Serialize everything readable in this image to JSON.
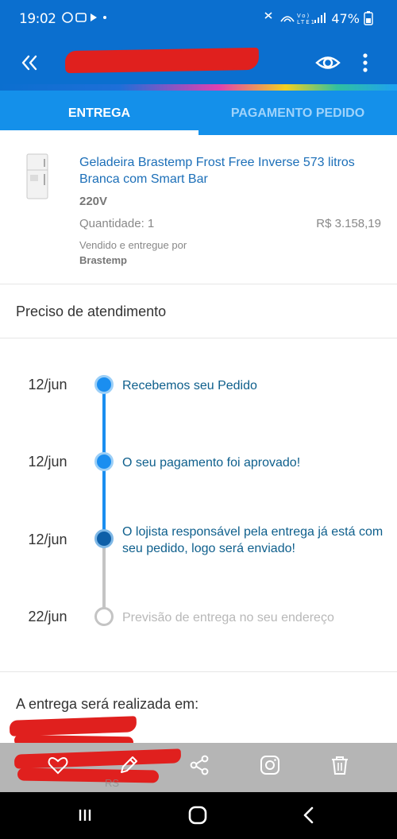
{
  "status_bar": {
    "time": "19:02",
    "battery": "47%"
  },
  "app_bar": {
    "back_icon": "double-chevron-left-icon",
    "eye_icon": "eye-icon",
    "more_icon": "more-vertical-icon"
  },
  "tabs": [
    {
      "label": "ENTREGA",
      "active": true
    },
    {
      "label": "PAGAMENTO PEDIDO",
      "active": false
    }
  ],
  "product": {
    "name": "Geladeira Brastemp Frost Free Inverse 573 litros Branca com Smart Bar",
    "voltage": "220V",
    "quantity": "Quantidade: 1",
    "price": "R$ 3.158,19",
    "sold_by_label": "Vendido e entregue por",
    "seller": "Brastemp"
  },
  "support": {
    "label": "Preciso de atendimento"
  },
  "timeline": [
    {
      "date": "12/jun",
      "text": "Recebemos seu Pedido",
      "status": "done"
    },
    {
      "date": "12/jun",
      "text": "O seu pagamento foi aprovado!",
      "status": "done"
    },
    {
      "date": "12/jun",
      "text": "O lojista responsável pela entrega já está com seu pedido, logo será enviado!",
      "status": "current"
    },
    {
      "date": "22/jun",
      "text": "Previsão de entrega no seu endereço",
      "status": "pending"
    }
  ],
  "delivery": {
    "label": "A entrega será realizada em:"
  },
  "action_bar": {
    "faint_text": "RS",
    "icons": [
      "heart-icon",
      "pencil-icon",
      "share-icon",
      "instagram-icon",
      "trash-icon"
    ]
  },
  "colors": {
    "primary": "#0b6fcf",
    "tab_bg": "#1490ea",
    "timeline_active": "#1a8ef0",
    "timeline_pending": "#c4c4c4",
    "product_name": "#1c6fb8"
  }
}
